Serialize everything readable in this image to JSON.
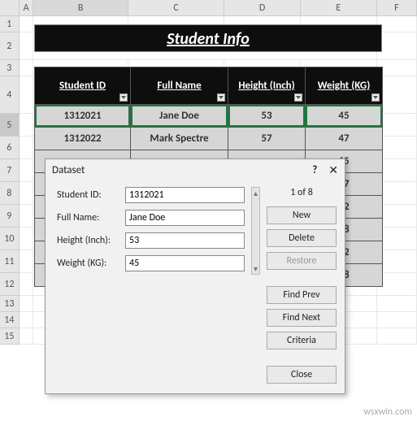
{
  "columns": [
    "A",
    "B",
    "C",
    "D",
    "E",
    "F"
  ],
  "rownums": [
    1,
    2,
    3,
    4,
    5,
    6,
    7,
    8,
    9,
    10,
    11,
    12,
    13,
    14,
    15
  ],
  "title": "Student Info",
  "headers": {
    "id": "Student ID",
    "name": "Full Name",
    "height": "Height (Inch)",
    "weight": "Weight (KG)"
  },
  "rows": [
    {
      "id": "1312021",
      "name": "Jane Doe",
      "h": "53",
      "w": "45"
    },
    {
      "id": "1312022",
      "name": "Mark Spectre",
      "h": "57",
      "w": "47"
    },
    {
      "id": "",
      "name": "",
      "h": "",
      "w": "65"
    },
    {
      "id": "",
      "name": "",
      "h": "",
      "w": "67"
    },
    {
      "id": "",
      "name": "",
      "h": "",
      "w": "52"
    },
    {
      "id": "",
      "name": "",
      "h": "",
      "w": "58"
    },
    {
      "id": "",
      "name": "",
      "h": "",
      "w": "72"
    },
    {
      "id": "",
      "name": "",
      "h": "",
      "w": "58"
    }
  ],
  "dialog": {
    "title": "Dataset",
    "help": "?",
    "close_x": "✕",
    "counter": "1 of 8",
    "fields": {
      "id_label": "Student ID:",
      "id_val": "1312021",
      "name_label": "Full Name:",
      "name_val": "Jane Doe",
      "h_label": "Height (Inch):",
      "h_val": "53",
      "w_label": "Weight (KG):",
      "w_val": "45"
    },
    "buttons": {
      "new": "New",
      "delete": "Delete",
      "restore": "Restore",
      "findprev": "Find Prev",
      "findnext": "Find Next",
      "criteria": "Criteria",
      "close": "Close"
    }
  },
  "watermark": "wsxwin.com"
}
